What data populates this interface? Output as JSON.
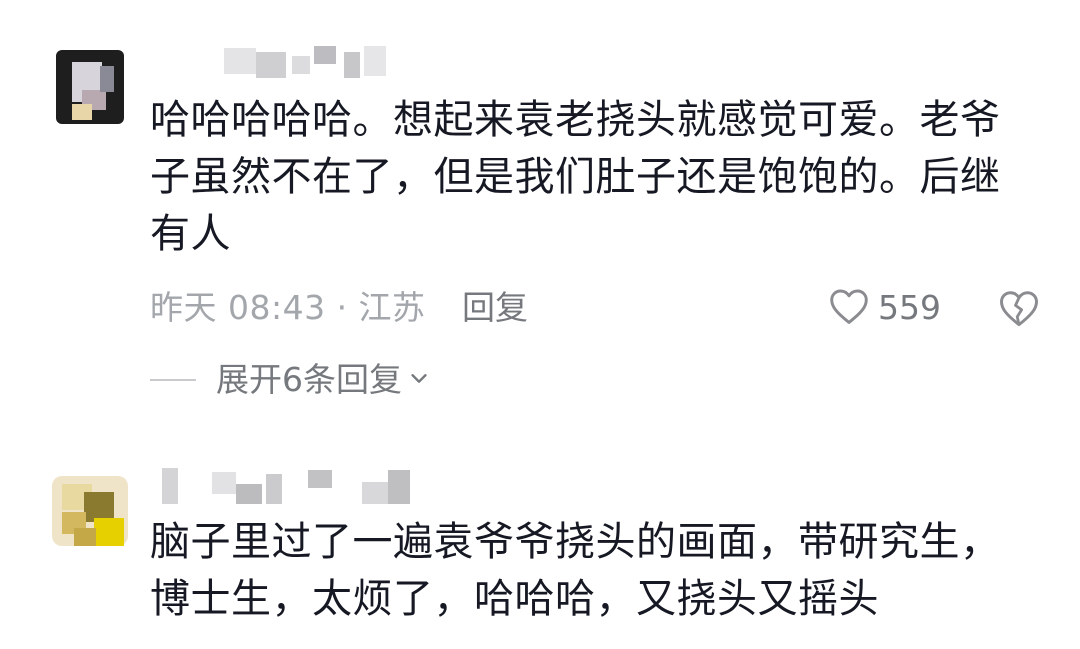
{
  "comments": [
    {
      "text": "哈哈哈哈哈。想起来袁老挠头就感觉可爱。老爷子虽然不在了，但是我们肚子还是饱饱的。后继有人",
      "time_location": "昨天 08:43 · 江苏",
      "reply_label": "回复",
      "like_count": "559",
      "expand_label": "展开6条回复"
    },
    {
      "text": "脑子里过了一遍袁爷爷挠头的画面，带研究生，博士生，太烦了，哈哈哈，又挠头又摇头"
    }
  ],
  "icons": {
    "like": "heart-outline-icon",
    "dislike": "broken-heart-icon",
    "expand": "chevron-down-icon"
  },
  "colors": {
    "text_primary": "#161823",
    "text_secondary": "#75787d",
    "text_tertiary": "#a3a6ab"
  }
}
